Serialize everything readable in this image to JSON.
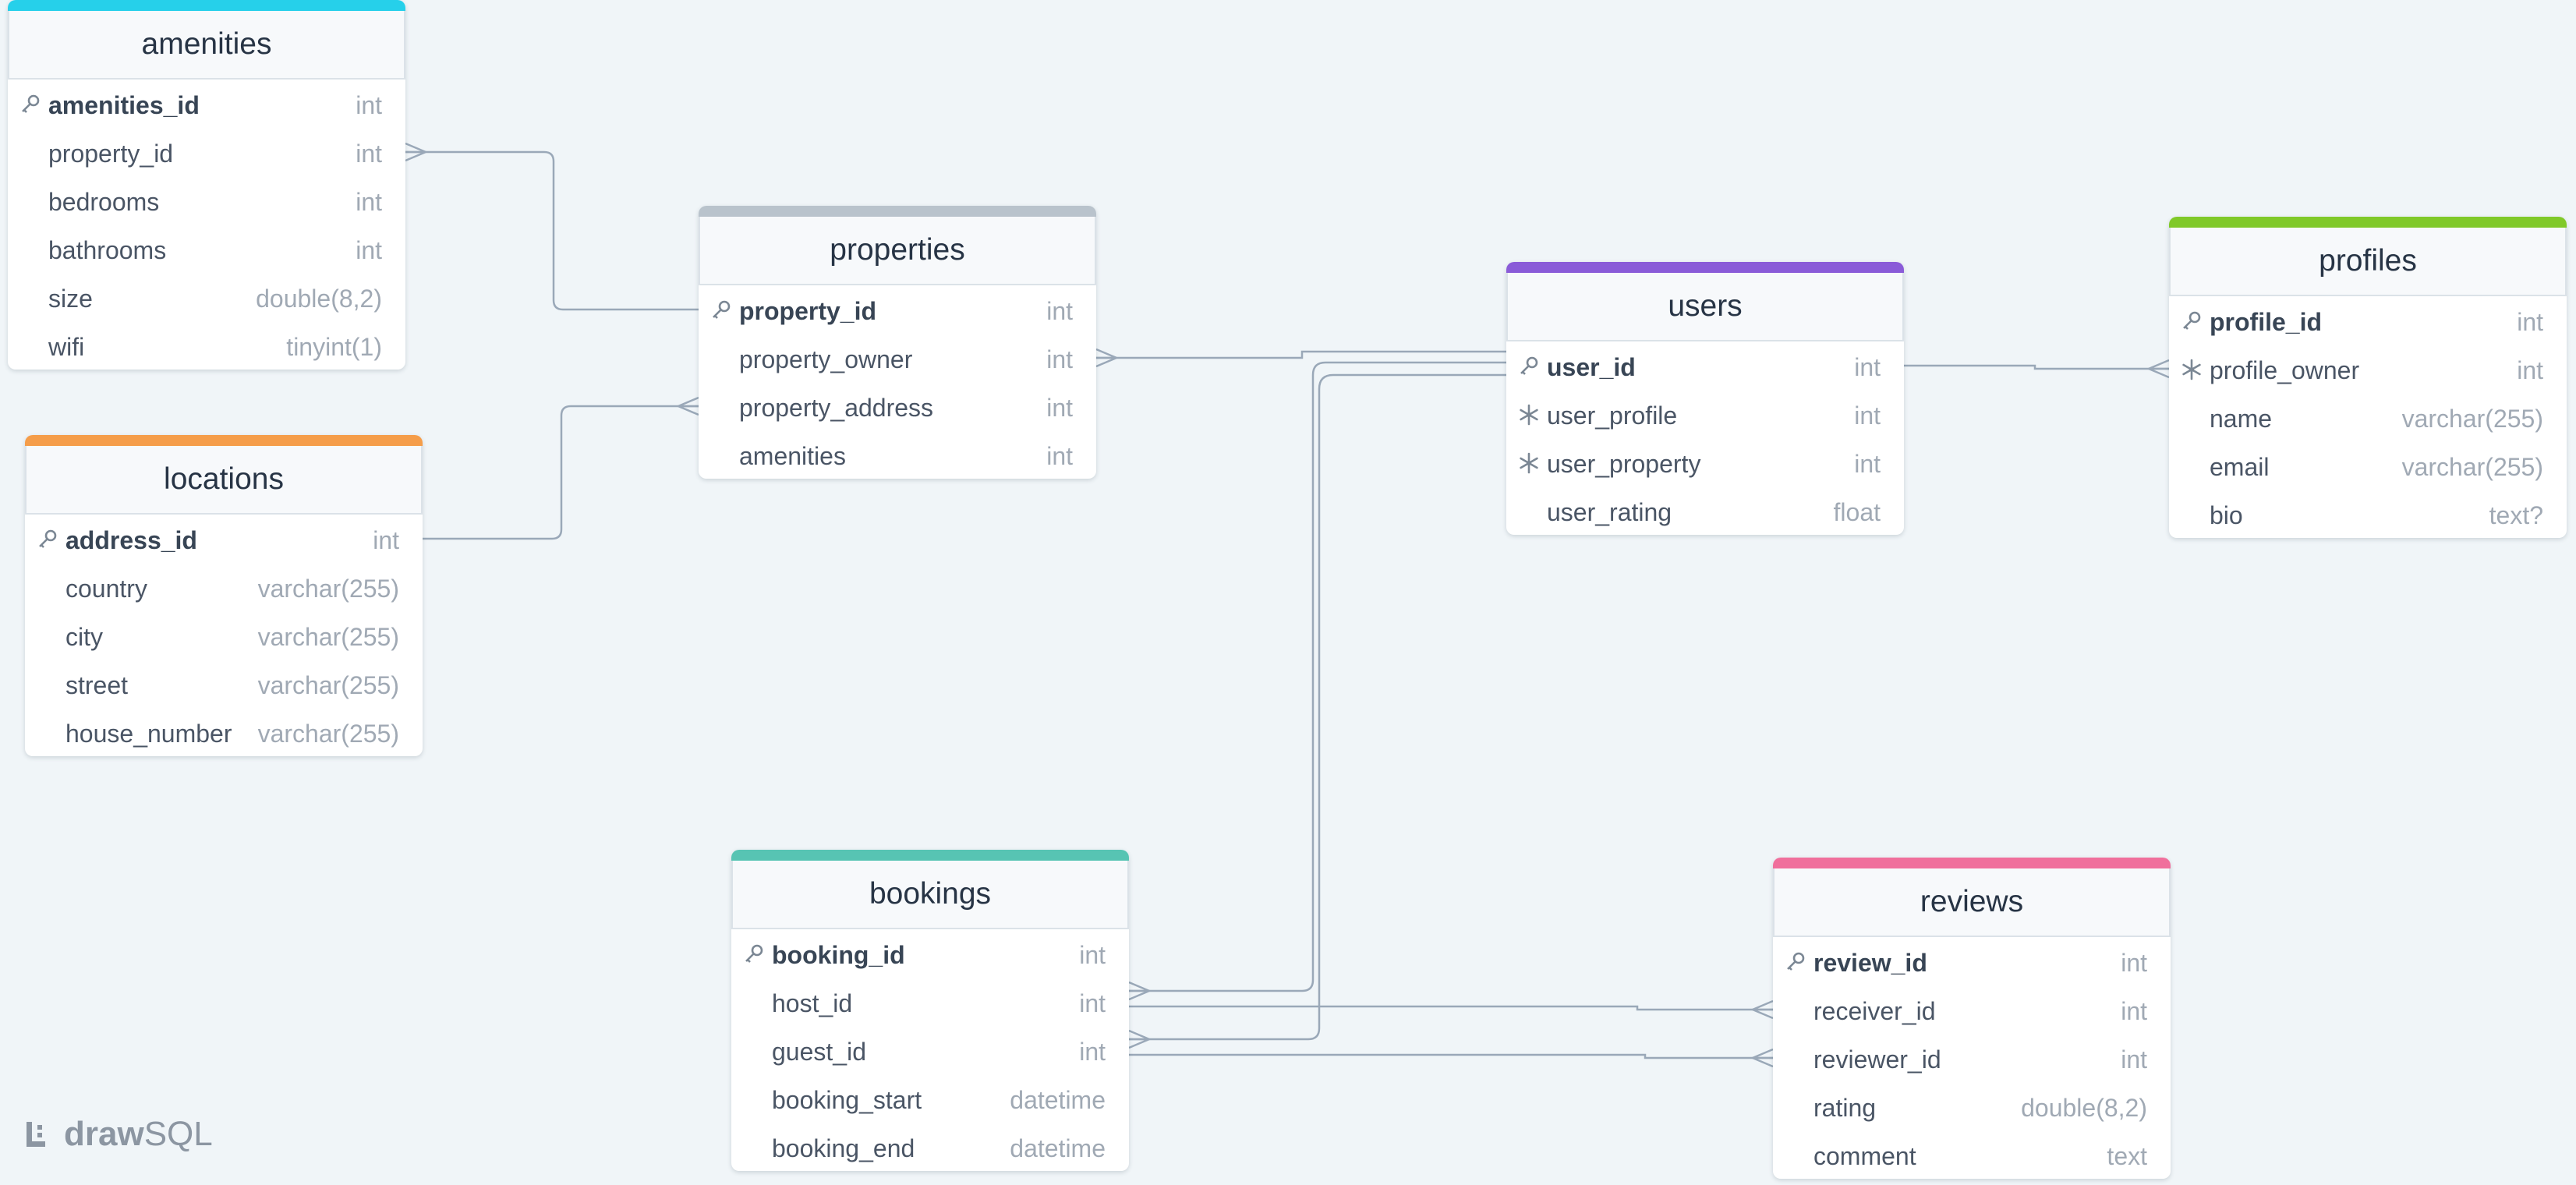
{
  "app": {
    "logo_bold": "draw",
    "logo_light": "SQL"
  },
  "colors": {
    "amenities": "#26d0ea",
    "properties": "#b9c3cc",
    "locations": "#f59d4a",
    "users": "#8a5bd8",
    "profiles": "#80c929",
    "bookings": "#57c4b3",
    "reviews": "#f06f9c",
    "line": "#9aa8b8"
  },
  "tables": [
    {
      "id": "amenities",
      "name": "amenities",
      "fields": [
        {
          "name": "amenities_id",
          "type": "int",
          "icon": "key-icon",
          "pk": true
        },
        {
          "name": "property_id",
          "type": "int"
        },
        {
          "name": "bedrooms",
          "type": "int"
        },
        {
          "name": "bathrooms",
          "type": "int"
        },
        {
          "name": "size",
          "type": "double(8,2)"
        },
        {
          "name": "wifi",
          "type": "tinyint(1)"
        }
      ]
    },
    {
      "id": "properties",
      "name": "properties",
      "fields": [
        {
          "name": "property_id",
          "type": "int",
          "icon": "key-icon",
          "pk": true
        },
        {
          "name": "property_owner",
          "type": "int"
        },
        {
          "name": "property_address",
          "type": "int"
        },
        {
          "name": "amenities",
          "type": "int"
        }
      ]
    },
    {
      "id": "locations",
      "name": "locations",
      "fields": [
        {
          "name": "address_id",
          "type": "int",
          "icon": "key-icon",
          "pk": true
        },
        {
          "name": "country",
          "type": "varchar(255)"
        },
        {
          "name": "city",
          "type": "varchar(255)"
        },
        {
          "name": "street",
          "type": "varchar(255)"
        },
        {
          "name": "house_number",
          "type": "varchar(255)"
        }
      ]
    },
    {
      "id": "users",
      "name": "users",
      "fields": [
        {
          "name": "user_id",
          "type": "int",
          "icon": "key-icon",
          "pk": true
        },
        {
          "name": "user_profile",
          "type": "int",
          "icon": "snowflake-icon"
        },
        {
          "name": "user_property",
          "type": "int",
          "icon": "snowflake-icon"
        },
        {
          "name": "user_rating",
          "type": "float"
        }
      ]
    },
    {
      "id": "profiles",
      "name": "profiles",
      "fields": [
        {
          "name": "profile_id",
          "type": "int",
          "icon": "key-icon",
          "pk": true
        },
        {
          "name": "profile_owner",
          "type": "int",
          "icon": "snowflake-icon"
        },
        {
          "name": "name",
          "type": "varchar(255)"
        },
        {
          "name": "email",
          "type": "varchar(255)"
        },
        {
          "name": "bio",
          "type": "text?"
        }
      ]
    },
    {
      "id": "bookings",
      "name": "bookings",
      "fields": [
        {
          "name": "booking_id",
          "type": "int",
          "icon": "key-icon",
          "pk": true
        },
        {
          "name": "host_id",
          "type": "int"
        },
        {
          "name": "guest_id",
          "type": "int"
        },
        {
          "name": "booking_start",
          "type": "datetime"
        },
        {
          "name": "booking_end",
          "type": "datetime"
        }
      ]
    },
    {
      "id": "reviews",
      "name": "reviews",
      "fields": [
        {
          "name": "review_id",
          "type": "int",
          "icon": "key-icon",
          "pk": true
        },
        {
          "name": "receiver_id",
          "type": "int"
        },
        {
          "name": "reviewer_id",
          "type": "int"
        },
        {
          "name": "rating",
          "type": "double(8,2)"
        },
        {
          "name": "comment",
          "type": "text"
        }
      ]
    }
  ],
  "relations": [
    {
      "from": "properties.property_id",
      "to": "amenities.property_id",
      "cardinality": "one-to-many"
    },
    {
      "from": "locations.address_id",
      "to": "properties.property_address",
      "cardinality": "one-to-many"
    },
    {
      "from": "users.user_id",
      "to": "properties.property_owner",
      "cardinality": "one-to-many"
    },
    {
      "from": "users.user_id",
      "to": "profiles.profile_owner",
      "cardinality": "one-to-many"
    },
    {
      "from": "users.user_id",
      "to": "bookings.host_id",
      "cardinality": "one-to-many"
    },
    {
      "from": "users.user_id",
      "to": "bookings.guest_id",
      "cardinality": "one-to-many"
    },
    {
      "from": "bookings.host_id",
      "to": "reviews.receiver_id",
      "cardinality": "one-to-many"
    },
    {
      "from": "bookings.guest_id",
      "to": "reviews.reviewer_id",
      "cardinality": "one-to-many"
    }
  ]
}
